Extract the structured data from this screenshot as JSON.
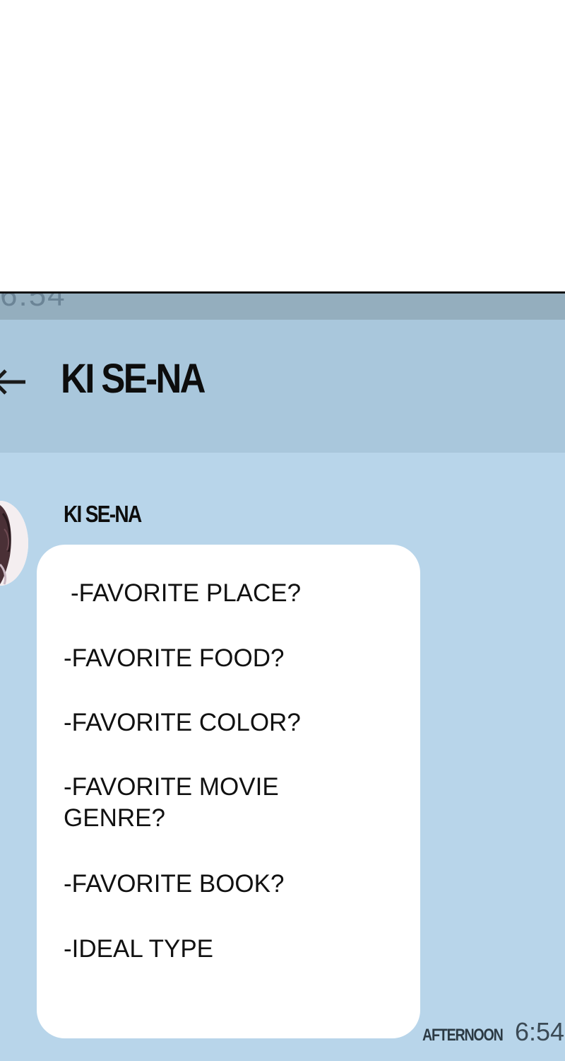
{
  "status_bar": {
    "time": "6:54"
  },
  "header": {
    "title": "KI SE-NA"
  },
  "message": {
    "sender": "KI SE-NA",
    "lines": [
      "-FAVORITE PLACE?",
      "-FAVORITE FOOD?",
      "-FAVORITE COLOR?",
      "-FAVORITE MOVIE\nGENRE?",
      "-FAVORITE BOOK?",
      "-IDEAL TYPE"
    ],
    "timestamp_period": "AFTERNOON",
    "timestamp_time": "6:54"
  },
  "colors": {
    "chat_background": "#b8d5ea",
    "header_background": "#a9c7dc",
    "status_bar_background": "#94aebe",
    "bubble": "#ffffff"
  },
  "icons": {
    "back": "arrow-left-icon"
  }
}
